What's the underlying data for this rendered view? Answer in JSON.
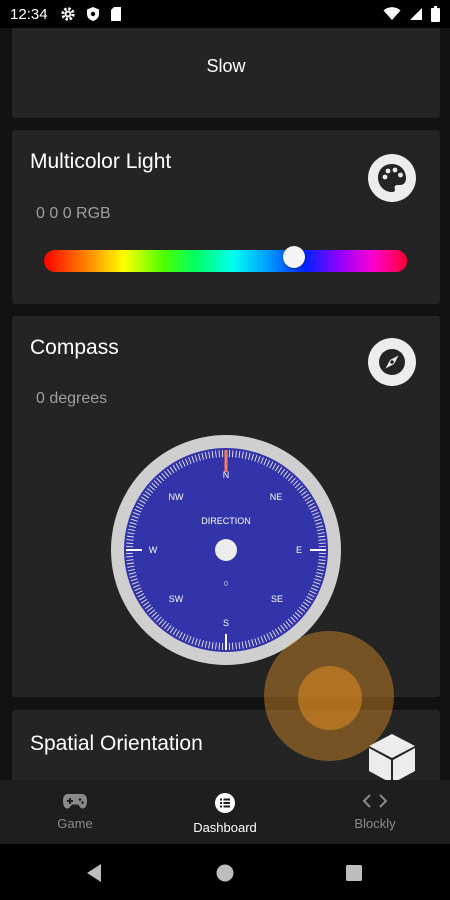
{
  "status_bar": {
    "time": "12:34"
  },
  "speed_card": {
    "value": "Slow"
  },
  "multicolor_card": {
    "title": "Multicolor Light",
    "value": "0 0 0 RGB",
    "icon": "palette-icon",
    "slider_fraction": 0.69
  },
  "compass_card": {
    "title": "Compass",
    "value": "0 degrees",
    "icon": "compass-icon",
    "dial": {
      "label": "DIRECTION",
      "digit": "0",
      "cardinals": [
        "N",
        "NE",
        "E",
        "SE",
        "S",
        "SW",
        "W",
        "NW"
      ],
      "face_color": "#3333aa",
      "needle_color": "#f08060"
    }
  },
  "spatial_card": {
    "title": "Spatial Orientation",
    "icon": "cube-icon"
  },
  "bottom_nav": {
    "items": [
      {
        "label": "Game",
        "icon": "gamepad-icon",
        "active": false
      },
      {
        "label": "Dashboard",
        "icon": "dashboard-list-icon",
        "active": true
      },
      {
        "label": "Blockly",
        "icon": "code-icon",
        "active": false
      }
    ]
  },
  "colors": {
    "card_bg": "#242424",
    "screen_bg": "#121212",
    "nav_bg": "#1e1e1e",
    "ripple": "#e6962a"
  }
}
